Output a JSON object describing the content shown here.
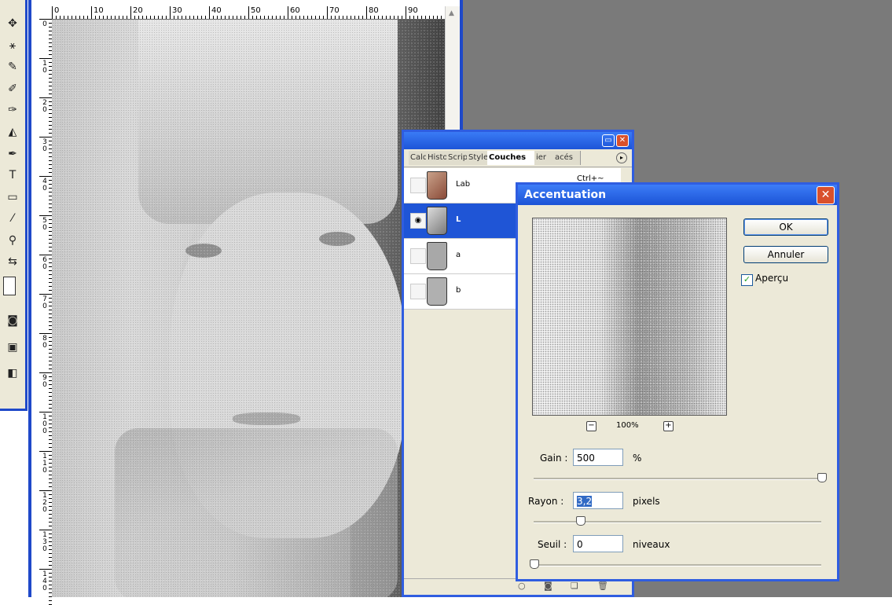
{
  "channels_panel": {
    "tabs": [
      "Calq",
      "Histo",
      "Scrip",
      "Style",
      "Couches",
      "ier",
      "acés"
    ],
    "rows": [
      {
        "name": "Lab",
        "shortcut": "Ctrl+~"
      },
      {
        "name": "L",
        "shortcut": ""
      },
      {
        "name": "a",
        "shortcut": ""
      },
      {
        "name": "b",
        "shortcut": ""
      }
    ],
    "colors": {
      "selected_row": "#1f55d6",
      "titlebar": "#2f5de0"
    }
  },
  "ruler": {
    "h_labels": [
      "0",
      "10",
      "20",
      "30",
      "40",
      "50",
      "60",
      "70",
      "80",
      "90"
    ],
    "v_labels": [
      "0",
      "1\n0",
      "2\n0",
      "3\n0",
      "4\n0",
      "5\n0",
      "6\n0",
      "7\n0",
      "8\n0",
      "9\n0",
      "1\n0\n0",
      "1\n1\n0",
      "1\n2\n0",
      "1\n3\n0",
      "1\n4\n0"
    ]
  },
  "dialog": {
    "title": "Accentuation",
    "ok_label": "OK",
    "cancel_label": "Annuler",
    "preview_label": "Aperçu",
    "preview_checked": true,
    "zoom_level": "100%",
    "gain": {
      "label": "Gain :",
      "value": "500",
      "unit": "%",
      "slider": 1.0
    },
    "radius": {
      "label": "Rayon :",
      "value": "3,2",
      "unit": "pixels",
      "slider": 0.16
    },
    "threshold": {
      "label": "Seuil :",
      "value": "0",
      "unit": "niveaux",
      "slider": 0.0
    }
  },
  "icons": {
    "eye": "eye-icon",
    "panel_menu": "panel-menu-icon",
    "close": "close-icon"
  }
}
